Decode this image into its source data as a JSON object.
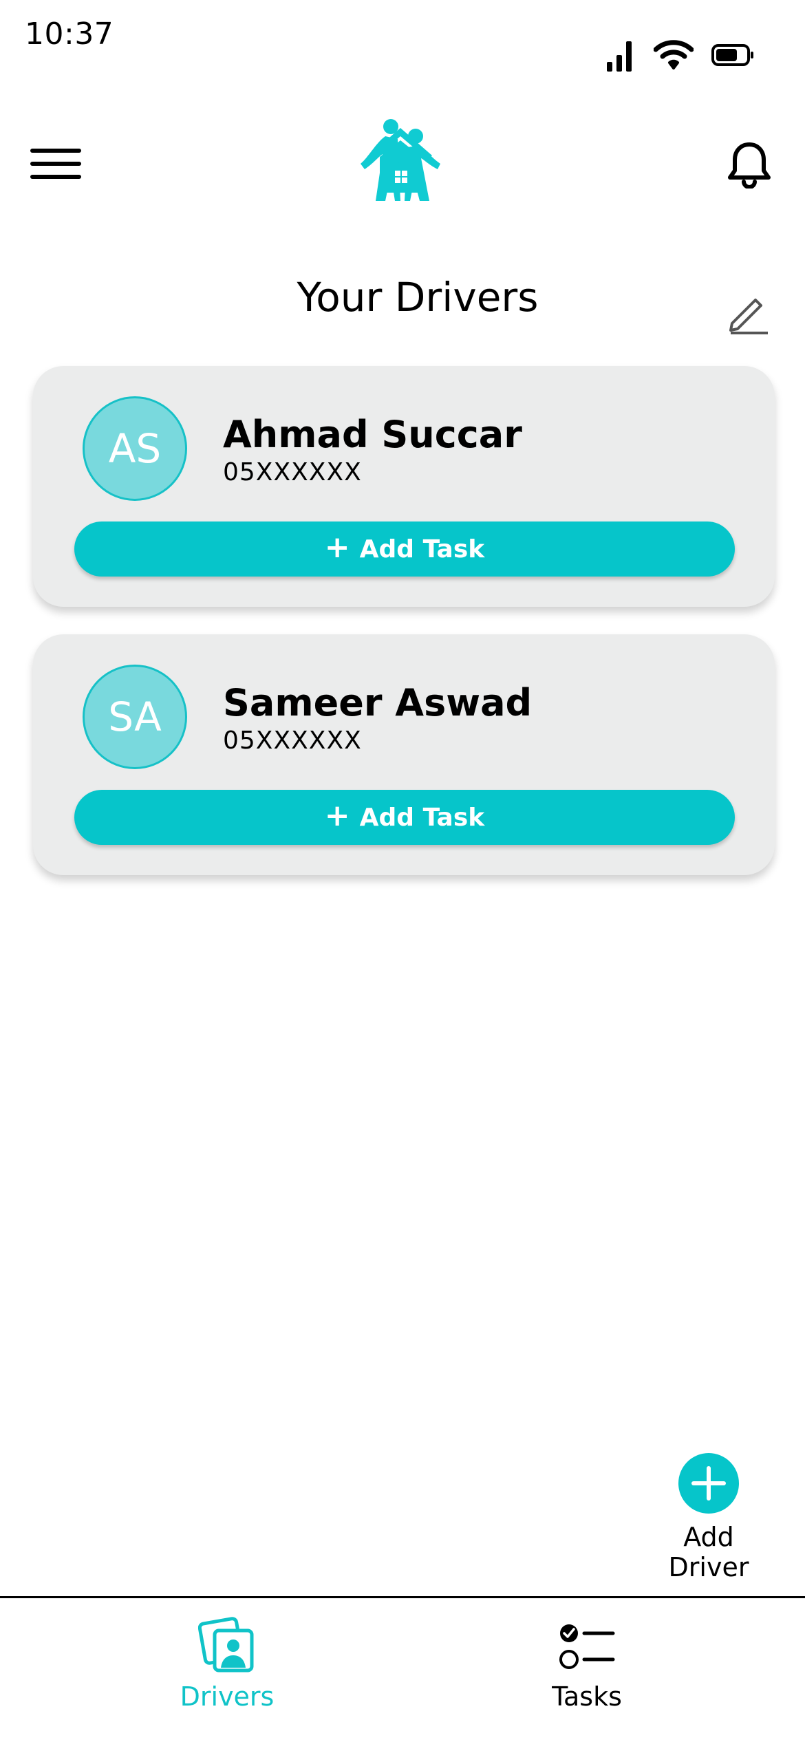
{
  "status_bar": {
    "time": "10:37",
    "icons": [
      "cellular-signal-icon",
      "wifi-icon",
      "battery-icon"
    ]
  },
  "header": {
    "menu_icon": "hamburger-menu-icon",
    "logo": "family-home-logo",
    "notification_icon": "bell-icon"
  },
  "page": {
    "title": "Your Drivers",
    "edit_icon": "pencil-icon"
  },
  "drivers": [
    {
      "initials": "AS",
      "name": "Ahmad Succar",
      "phone": "05XXXXXX",
      "action_label": "Add Task"
    },
    {
      "initials": "SA",
      "name": "Sameer Aswad",
      "phone": "05XXXXXX",
      "action_label": "Add Task"
    }
  ],
  "fab": {
    "label": "Add Driver",
    "icon": "plus-icon"
  },
  "bottom_nav": {
    "items": [
      {
        "label": "Drivers",
        "icon": "drivers-photo-icon",
        "active": true
      },
      {
        "label": "Tasks",
        "icon": "task-list-icon",
        "active": false
      }
    ]
  },
  "colors": {
    "accent": "#06c5ca",
    "avatar_fill": "#79d9dd",
    "card_bg": "#ebecec",
    "logo": "#10cbd2",
    "nav_active": "#10c3c8",
    "text": "#000000"
  }
}
